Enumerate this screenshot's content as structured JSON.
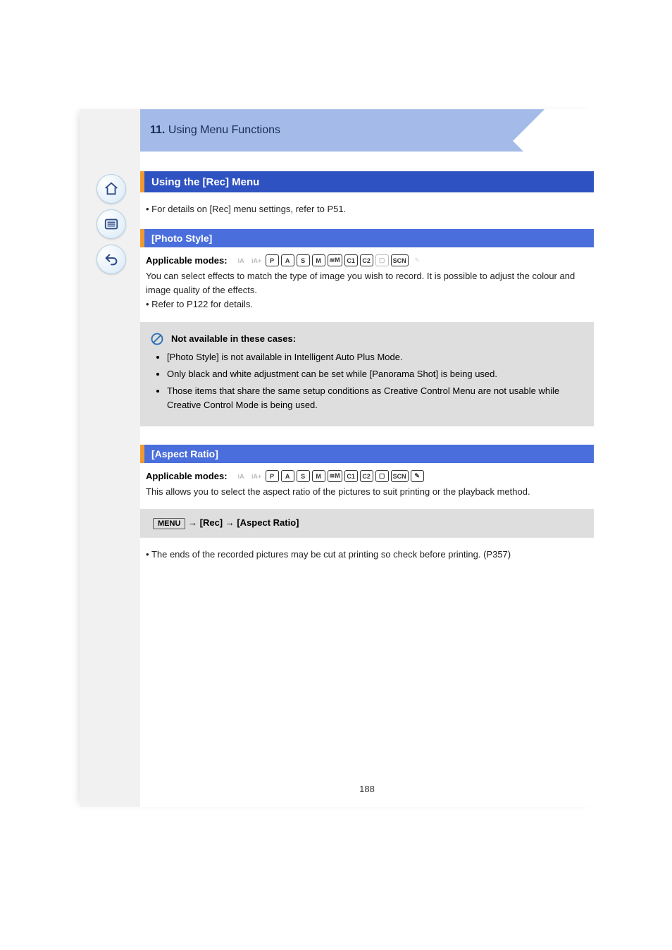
{
  "banner": {
    "category": "11.",
    "title": "Using Menu Functions"
  },
  "section_title": "Using the [Rec] Menu",
  "intro": "For details on [Rec] menu settings, refer to P51.",
  "photo_style": {
    "heading": "[Photo Style]",
    "modes_label": "Applicable modes:",
    "desc": "You can select effects to match the type of image you wish to record. It is possible to adjust the colour and image quality of the effects.",
    "cross_ref": "Refer to P122 for details."
  },
  "aspect_ratio": {
    "heading": "[Aspect Ratio]",
    "modes_label": "Applicable modes:",
    "desc": "This allows you to select the aspect ratio of the pictures to suit printing or the playback method.",
    "menu_path_prefix": "MENU",
    "menu_path": "→ [Rec] → [Aspect Ratio]"
  },
  "not_available": {
    "title": "Not available in these cases:",
    "items": [
      "[Photo Style] is not available in Intelligent Auto Plus Mode.",
      "Only black and white adjustment can be set while [Panorama Shot] is being used.",
      "Those items that share the same setup conditions as Creative Control Menu are not usable while Creative Control Mode is being used."
    ]
  },
  "aspect_note": "The ends of the recorded pictures may be cut at printing so check before printing. (P357)",
  "page_number": "188",
  "mode_chips": {
    "row1": [
      "iA",
      "iA+",
      "P",
      "A",
      "S",
      "M",
      "≊M",
      "C1",
      "C2",
      "▢",
      "SCN",
      "✎"
    ],
    "row2": [
      "iA",
      "iA+",
      "P",
      "A",
      "S",
      "M",
      "≊M",
      "C1",
      "C2",
      "▢",
      "SCN",
      "✎"
    ]
  },
  "sidebar": {
    "home": "home-icon",
    "list": "list-icon",
    "back": "back-icon"
  }
}
